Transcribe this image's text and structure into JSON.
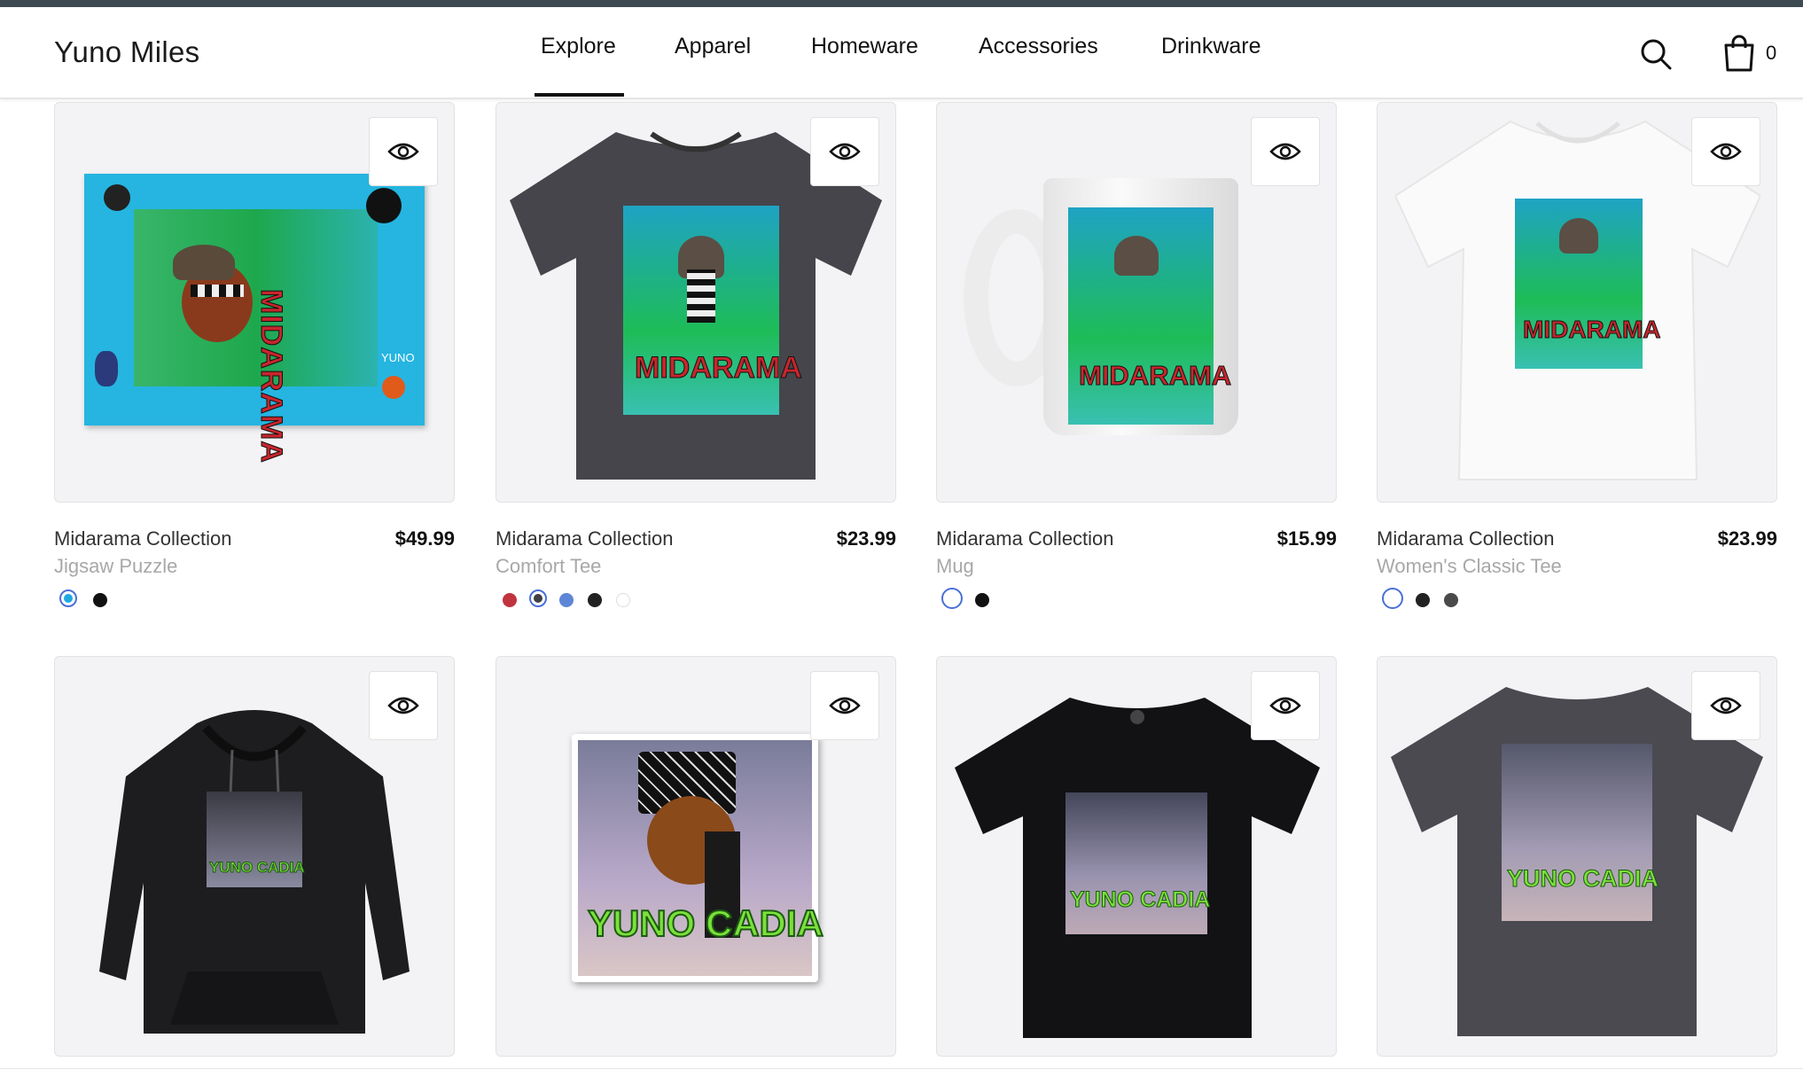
{
  "brand": "Yuno Miles",
  "nav": [
    "Explore",
    "Apparel",
    "Homeware",
    "Accessories",
    "Drinkware"
  ],
  "active_nav": "Explore",
  "cart_count": "0",
  "icons": {
    "search": "search-icon",
    "cart": "shopping-bag-icon",
    "quick_view": "eye-icon"
  },
  "products": [
    {
      "title": "Midarama Collection",
      "subtitle": "Jigsaw Puzzle",
      "price": "$49.99",
      "colors": [
        "#1fa9e0",
        "#111111"
      ],
      "selected": 0
    },
    {
      "title": "Midarama Collection",
      "subtitle": "Comfort Tee",
      "price": "$23.99",
      "colors": [
        "#c0343e",
        "#3f3f45",
        "#5d86d6",
        "#222222",
        "#ffffff"
      ],
      "selected": 1
    },
    {
      "title": "Midarama Collection",
      "subtitle": "Mug",
      "price": "$15.99",
      "colors": [
        "#ffffff",
        "#111111"
      ],
      "selected": 0
    },
    {
      "title": "Midarama Collection",
      "subtitle": "Women's Classic Tee",
      "price": "$23.99",
      "colors": [
        "#ffffff",
        "#222222",
        "#4a4a4a"
      ],
      "selected": 0
    },
    {
      "title": "",
      "subtitle": "",
      "price": "",
      "colors": [],
      "selected": -1
    },
    {
      "title": "",
      "subtitle": "",
      "price": "",
      "colors": [],
      "selected": -1
    },
    {
      "title": "",
      "subtitle": "",
      "price": "",
      "colors": [],
      "selected": -1
    },
    {
      "title": "",
      "subtitle": "",
      "price": "",
      "colors": [],
      "selected": -1
    }
  ],
  "artwork": {
    "row1": "MIDARAMA",
    "row2": "YUNO CADIA",
    "puzzle_corner": "YUNO"
  }
}
